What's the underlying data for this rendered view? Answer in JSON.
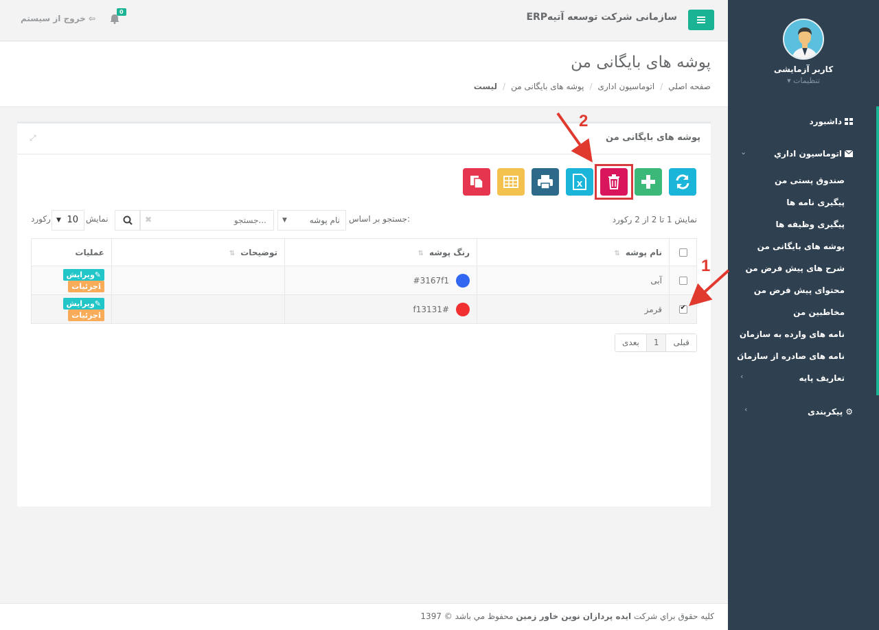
{
  "topbar": {
    "app_title": "ERPسازمانی شرکت توسعه آتیه",
    "notification_count": "0",
    "logout_label": "خروج از سیستم"
  },
  "sidebar": {
    "user_name": "کاربر آزمایشی",
    "settings_label": "▾ تنظیمات",
    "dashboard": "داشبورد",
    "office_automation": "اتوماسیون اداري",
    "items": [
      {
        "label": "صندوق پستی من"
      },
      {
        "label": "پیگیری نامه ها"
      },
      {
        "label": "پیگیری وظیفه ها"
      },
      {
        "label": "پوشه های بایگانی من"
      },
      {
        "label": "شرح های پیش فرض من"
      },
      {
        "label": "محتوای پیش فرض من"
      },
      {
        "label": "مخاطبین من"
      },
      {
        "label": "نامه های وارده به سازمان"
      },
      {
        "label": "نامه های صادره از سازمان"
      },
      {
        "label": "تعاریف پایه"
      }
    ],
    "configuration": "پیکربندی"
  },
  "page": {
    "title": "پوشه های بایگانی من",
    "breadcrumb": [
      "صفحه اصلي",
      "اتوماسیون اداری",
      "پوشه های بایگانی من",
      "لیست"
    ]
  },
  "panel": {
    "title": "پوشه های بایگانی من",
    "info": "نمایش 1 تا 2 از 2 رکورد",
    "search_by_label": "جستجو بر اساس:",
    "search_field_selected": "نام پوشه",
    "search_placeholder": "جستجو...",
    "show_label": "نمایش",
    "page_length": "10",
    "records_label": "رکورد"
  },
  "table": {
    "headers": [
      "نام پوشه",
      "رنگ پوشه",
      "توضیحات",
      "عملیات"
    ],
    "rows": [
      {
        "name": "آبی",
        "color": "#3167f1",
        "color_label": "#3167f1",
        "description": "",
        "checked": false
      },
      {
        "name": "قرمز",
        "color": "#f13131",
        "color_label": "f13131#",
        "description": "",
        "checked": true
      }
    ],
    "edit_label": "ویرایش",
    "details_label": "جزئیات"
  },
  "pagination": {
    "prev": "قبلی",
    "current": "1",
    "next": "بعدی"
  },
  "annotations": [
    "1",
    "2"
  ],
  "footer": {
    "prefix": "کلیه حقوق براي شرکت",
    "company": "ایده پردازان نوین خاور زمین",
    "suffix": "محفوظ مي باشد © 1397"
  },
  "colors": {
    "sidebar": "#2f4050",
    "accent": "#1ab394",
    "refresh": "#1ab5d8",
    "add": "#3cb878",
    "delete": "#d9155c",
    "excel": "#1ab5d8",
    "print": "#2d6a8a",
    "columns": "#f2c14e",
    "copy": "#e5354f"
  }
}
